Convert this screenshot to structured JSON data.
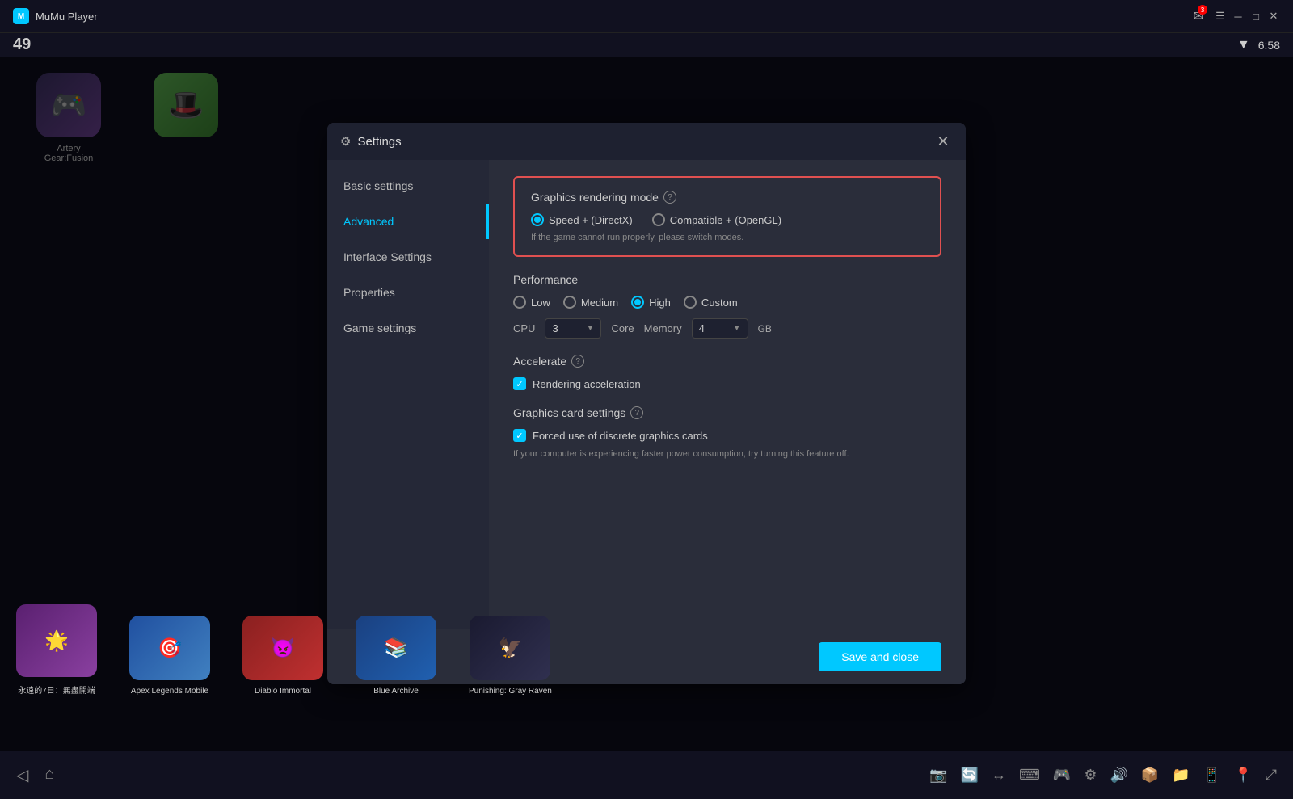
{
  "app": {
    "title": "MuMu Player",
    "battery": "49",
    "time": "6:58",
    "notification_count": "3"
  },
  "topbar": {
    "minimize": "─",
    "maximize": "□",
    "close": "✕"
  },
  "dialog": {
    "title": "Settings",
    "close_label": "✕"
  },
  "sidebar": {
    "items": [
      {
        "id": "basic-settings",
        "label": "Basic settings",
        "active": false
      },
      {
        "id": "advanced",
        "label": "Advanced",
        "active": true
      },
      {
        "id": "interface-settings",
        "label": "Interface Settings",
        "active": false
      },
      {
        "id": "properties",
        "label": "Properties",
        "active": false
      },
      {
        "id": "game-settings",
        "label": "Game settings",
        "active": false
      }
    ]
  },
  "rendering_mode": {
    "title": "Graphics rendering mode",
    "options": [
      {
        "id": "speed-directx",
        "label": "Speed + (DirectX)",
        "selected": true
      },
      {
        "id": "compatible-opengl",
        "label": "Compatible + (OpenGL)",
        "selected": false
      }
    ],
    "hint": "If the game cannot run properly, please switch modes."
  },
  "performance": {
    "title": "Performance",
    "options": [
      {
        "id": "low",
        "label": "Low",
        "selected": false
      },
      {
        "id": "medium",
        "label": "Medium",
        "selected": false
      },
      {
        "id": "high",
        "label": "High",
        "selected": true
      },
      {
        "id": "custom",
        "label": "Custom",
        "selected": false
      }
    ],
    "cpu_label": "CPU",
    "cpu_value": "3",
    "core_label": "Core",
    "memory_label": "Memory",
    "memory_value": "4",
    "gb_label": "GB"
  },
  "accelerate": {
    "title": "Accelerate",
    "rendering_label": "Rendering acceleration",
    "rendering_checked": true
  },
  "graphics_card": {
    "title": "Graphics card settings",
    "forced_label": "Forced use of discrete graphics cards",
    "forced_checked": true,
    "warn_text": "If your computer is experiencing faster power consumption, try turning this feature off."
  },
  "footer": {
    "save_label": "Save and close"
  },
  "games_top": [
    {
      "id": "artery-gear",
      "label": "Artery Gear:Fusion",
      "color": "#3a3060",
      "emoji": "🎮"
    },
    {
      "id": "icon2",
      "label": "",
      "color": "#4a8a40",
      "emoji": "🎩"
    }
  ],
  "games_bottom": [
    {
      "id": "eternal-7days",
      "label": "永遠的7日：無盡開端",
      "color": "#6a3080",
      "emoji": "🌟"
    },
    {
      "id": "apex-legends",
      "label": "Apex Legends Mobile",
      "color": "#3060a0",
      "emoji": "🎯"
    },
    {
      "id": "diablo-immortal",
      "label": "Diablo Immortal",
      "color": "#8a2020",
      "emoji": "👿"
    },
    {
      "id": "blue-archive",
      "label": "Blue Archive",
      "color": "#2050a0",
      "emoji": "📚"
    },
    {
      "id": "punishing-gray",
      "label": "Punishing: Gray Raven",
      "color": "#202040",
      "emoji": "🦅"
    }
  ]
}
